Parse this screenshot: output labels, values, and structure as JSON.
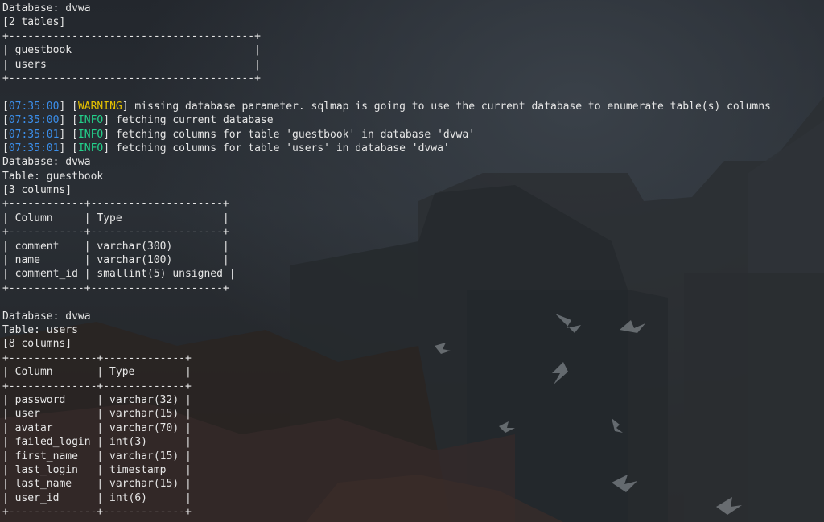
{
  "colors": {
    "timestamp": "#3b8eea",
    "warning": "#e5c100",
    "info": "#23d18b",
    "text": "#e6e6e6"
  },
  "terminal": {
    "lines": [
      {
        "type": "text",
        "text": "Database: dvwa"
      },
      {
        "type": "text",
        "text": "[2 tables]"
      },
      {
        "type": "text",
        "text": "+---------------------------------------+"
      },
      {
        "type": "text",
        "text": "| guestbook                             |"
      },
      {
        "type": "text",
        "text": "| users                                 |"
      },
      {
        "type": "text",
        "text": "+---------------------------------------+"
      },
      {
        "type": "text",
        "text": ""
      },
      {
        "type": "log",
        "time": "07:35:00",
        "level": "WARNING",
        "msg": "missing database parameter. sqlmap is going to use the current database to enumerate table(s) columns"
      },
      {
        "type": "log",
        "time": "07:35:00",
        "level": "INFO",
        "msg": "fetching current database"
      },
      {
        "type": "log",
        "time": "07:35:01",
        "level": "INFO",
        "msg": "fetching columns for table 'guestbook' in database 'dvwa'"
      },
      {
        "type": "log",
        "time": "07:35:01",
        "level": "INFO",
        "msg": "fetching columns for table 'users' in database 'dvwa'"
      },
      {
        "type": "text",
        "text": "Database: dvwa"
      },
      {
        "type": "text",
        "text": "Table: guestbook"
      },
      {
        "type": "text",
        "text": "[3 columns]"
      },
      {
        "type": "text",
        "text": "+------------+---------------------+"
      },
      {
        "type": "text",
        "text": "| Column     | Type                |"
      },
      {
        "type": "text",
        "text": "+------------+---------------------+"
      },
      {
        "type": "text",
        "text": "| comment    | varchar(300)        |"
      },
      {
        "type": "text",
        "text": "| name       | varchar(100)        |"
      },
      {
        "type": "text",
        "text": "| comment_id | smallint(5) unsigned |"
      },
      {
        "type": "text",
        "text": "+------------+---------------------+"
      },
      {
        "type": "text",
        "text": ""
      },
      {
        "type": "text",
        "text": "Database: dvwa"
      },
      {
        "type": "text",
        "text": "Table: users"
      },
      {
        "type": "text",
        "text": "[8 columns]"
      },
      {
        "type": "text",
        "text": "+--------------+-------------+"
      },
      {
        "type": "text",
        "text": "| Column       | Type        |"
      },
      {
        "type": "text",
        "text": "+--------------+-------------+"
      },
      {
        "type": "text",
        "text": "| password     | varchar(32) |"
      },
      {
        "type": "text",
        "text": "| user         | varchar(15) |"
      },
      {
        "type": "text",
        "text": "| avatar       | varchar(70) |"
      },
      {
        "type": "text",
        "text": "| failed_login | int(3)      |"
      },
      {
        "type": "text",
        "text": "| first_name   | varchar(15) |"
      },
      {
        "type": "text",
        "text": "| last_login   | timestamp   |"
      },
      {
        "type": "text",
        "text": "| last_name    | varchar(15) |"
      },
      {
        "type": "text",
        "text": "| user_id      | int(6)      |"
      },
      {
        "type": "text",
        "text": "+--------------+-------------+"
      }
    ]
  }
}
